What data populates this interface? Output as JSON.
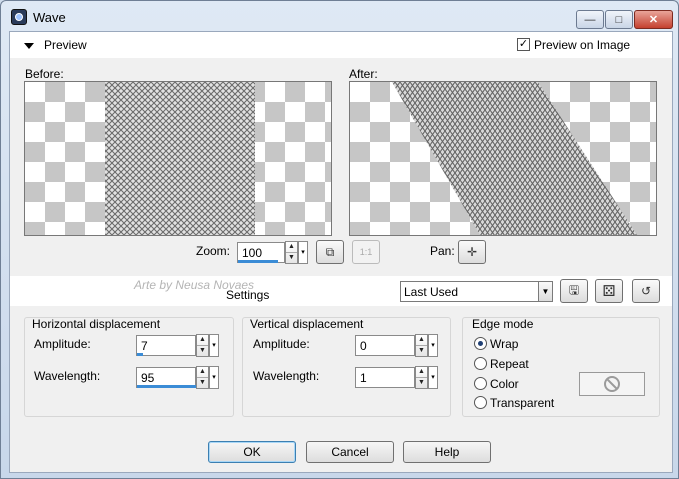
{
  "window": {
    "title": "Wave",
    "minimize_glyph": "—",
    "maximize_glyph": "□",
    "close_glyph": "✕"
  },
  "preview": {
    "label": "Preview",
    "preview_on_image_label": "Preview on Image",
    "preview_on_image_checked": true,
    "before_label": "Before:",
    "after_label": "After:",
    "zoom_label": "Zoom:",
    "zoom_value": "100",
    "pan_label": "Pan:",
    "fit_icon_glyph": "⧉",
    "actual_size_icon_glyph": "1:1",
    "pan_icon_glyph": "✛"
  },
  "settings": {
    "watermark": "Arte by Neusa Novaes",
    "label": "Settings",
    "preset_value": "Last Used",
    "save_icon_glyph": "🖫",
    "random_icon_glyph": "⚄",
    "reset_icon_glyph": "↺"
  },
  "horizontal": {
    "title": "Horizontal displacement",
    "amplitude_label": "Amplitude:",
    "amplitude_value": "7",
    "wavelength_label": "Wavelength:",
    "wavelength_value": "95"
  },
  "vertical": {
    "title": "Vertical displacement",
    "amplitude_label": "Amplitude:",
    "amplitude_value": "0",
    "wavelength_label": "Wavelength:",
    "wavelength_value": "1"
  },
  "edge_mode": {
    "title": "Edge mode",
    "options": [
      "Wrap",
      "Repeat",
      "Color",
      "Transparent"
    ],
    "selected": "Wrap",
    "no_color_glyph": "⃠"
  },
  "buttons": {
    "ok": "OK",
    "cancel": "Cancel",
    "help": "Help"
  },
  "colors": {
    "accent": "#3b8cd6",
    "title_bar": "#c8d7ea",
    "close_button": "#c4402f"
  }
}
